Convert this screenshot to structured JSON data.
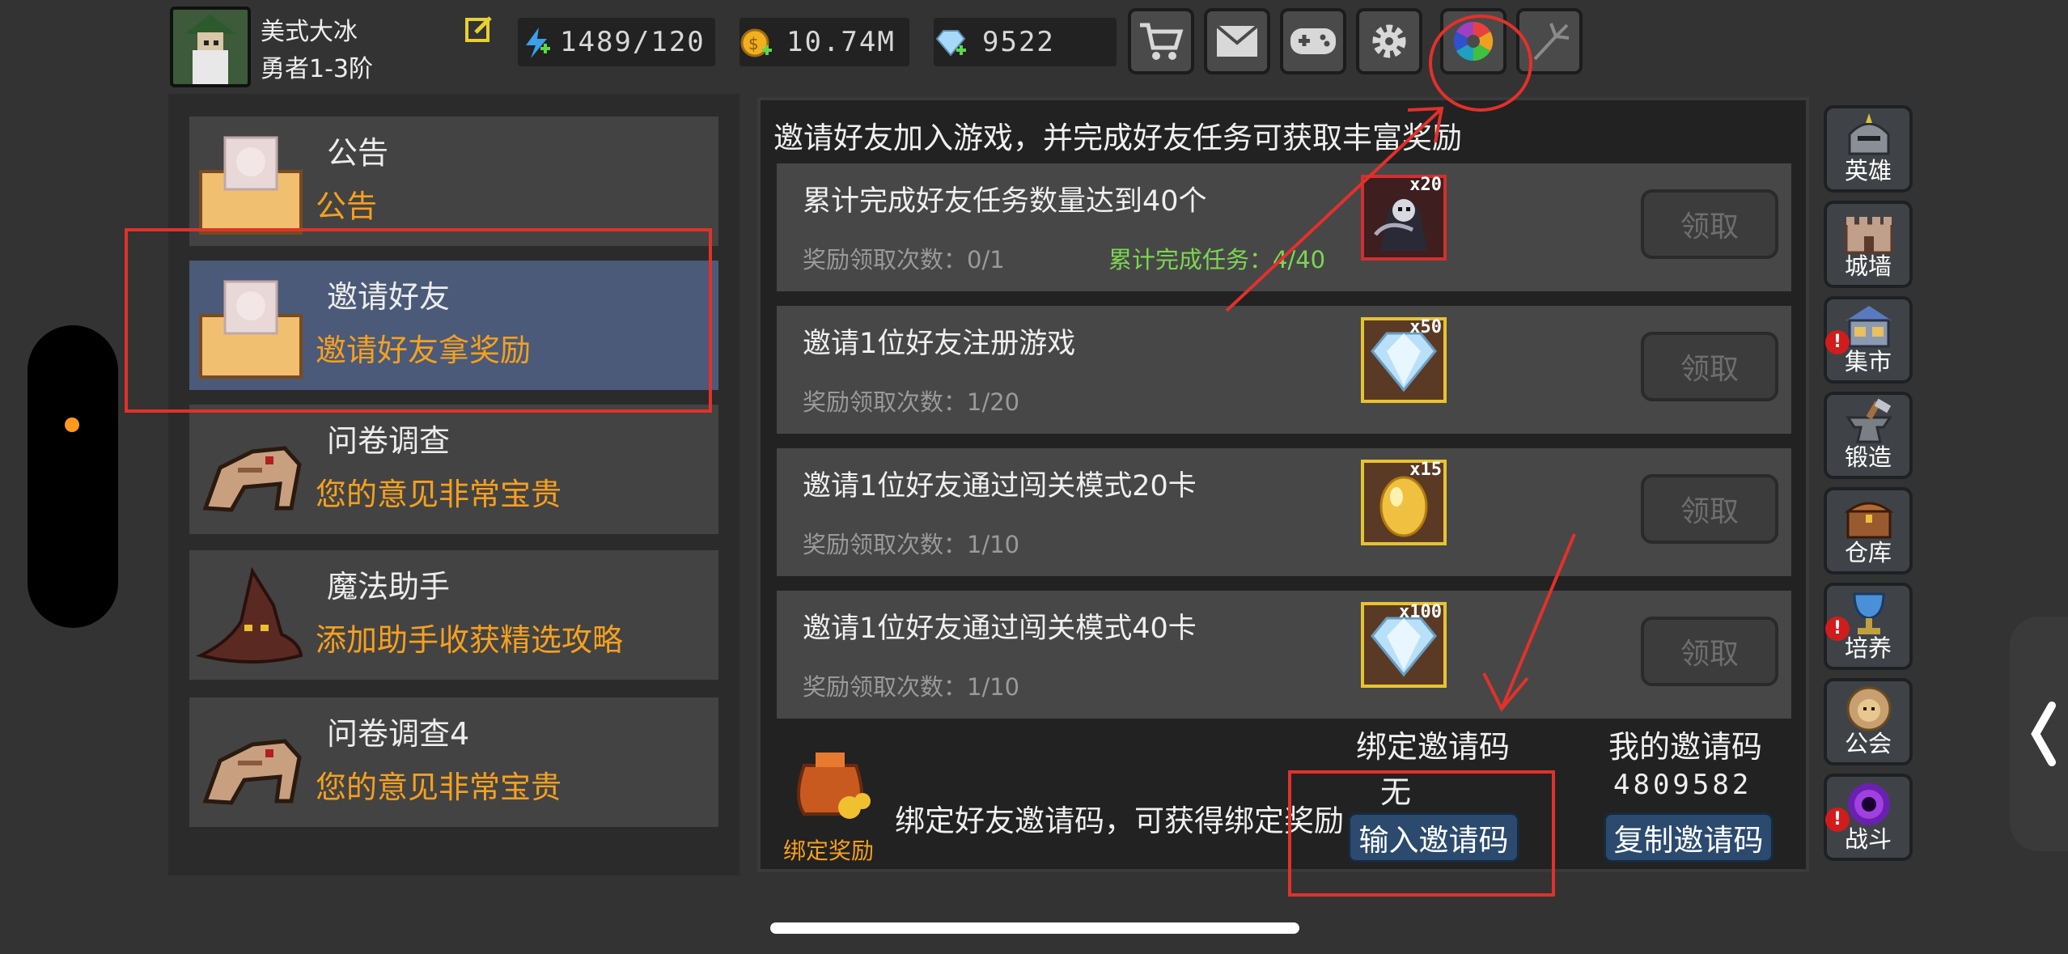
{
  "player": {
    "name": "美式大冰",
    "rank": "勇者1-3阶"
  },
  "resources": [
    {
      "icon": "energy-icon",
      "value": "1489/120"
    },
    {
      "icon": "gold-coin-icon",
      "value": "10.74M"
    },
    {
      "icon": "diamond-icon",
      "value": "9522"
    }
  ],
  "top_buttons": [
    "shop-cart-icon",
    "mail-icon",
    "gamepad-icon",
    "settings-gear-icon",
    "color-wheel-icon",
    "fireworks-icon"
  ],
  "left_menu": [
    {
      "title": "公告",
      "subtitle": "公告",
      "icon": "envelope-icon",
      "selected": false
    },
    {
      "title": "邀请好友",
      "subtitle": "邀请好友拿奖励",
      "icon": "envelope-icon",
      "selected": true
    },
    {
      "title": "问卷调查",
      "subtitle": "您的意见非常宝贵",
      "icon": "beast-icon",
      "selected": false
    },
    {
      "title": "魔法助手",
      "subtitle": "添加助手收获精选攻略",
      "icon": "wizard-hat-icon",
      "selected": false
    },
    {
      "title": "问卷调查4",
      "subtitle": "您的意见非常宝贵",
      "icon": "beast-icon",
      "selected": false
    }
  ],
  "invite_panel": {
    "header": "邀请好友加入游戏，并完成好友任务可获取丰富奖励",
    "tasks": [
      {
        "title": "累计完成好友任务数量达到40个",
        "count": "奖励领取次数：0/1",
        "progress": "累计完成任务：4/40",
        "reward_icon": "reaper-icon",
        "reward_mult": "x20",
        "button": "领取"
      },
      {
        "title": "邀请1位好友注册游戏",
        "count": "奖励领取次数：1/20",
        "progress": "",
        "reward_icon": "diamond-icon",
        "reward_mult": "x50",
        "button": "领取"
      },
      {
        "title": "邀请1位好友通过闯关模式20卡",
        "count": "奖励领取次数：1/10",
        "progress": "",
        "reward_icon": "golden-egg-icon",
        "reward_mult": "x15",
        "button": "领取"
      },
      {
        "title": "邀请1位好友通过闯关模式40卡",
        "count": "奖励领取次数：1/10",
        "progress": "",
        "reward_icon": "diamond-icon",
        "reward_mult": "x100",
        "button": "领取"
      }
    ],
    "bind": {
      "reward_label": "绑定奖励",
      "description": "绑定好友邀请码，可获得绑定奖励",
      "bind_title": "绑定邀请码",
      "bind_value": "无",
      "bind_button": "输入邀请码",
      "my_title": "我的邀请码",
      "my_code": "4809582",
      "copy_button": "复制邀请码"
    }
  },
  "side_nav": [
    {
      "label": "英雄",
      "icon": "helmet-icon",
      "alert": false
    },
    {
      "label": "城墙",
      "icon": "castle-wall-icon",
      "alert": false
    },
    {
      "label": "集市",
      "icon": "market-stall-icon",
      "alert": true
    },
    {
      "label": "锻造",
      "icon": "anvil-icon",
      "alert": false
    },
    {
      "label": "仓库",
      "icon": "treasure-chest-icon",
      "alert": false
    },
    {
      "label": "培养",
      "icon": "chalice-icon",
      "alert": true
    },
    {
      "label": "公会",
      "icon": "lion-emblem-icon",
      "alert": false
    },
    {
      "label": "战斗",
      "icon": "portal-icon",
      "alert": true
    }
  ],
  "colors": {
    "accent_orange": "#f5a020",
    "progress_green": "#7cd652",
    "selected_blue": "#4a5a78",
    "annotation_red": "#e2312a"
  }
}
